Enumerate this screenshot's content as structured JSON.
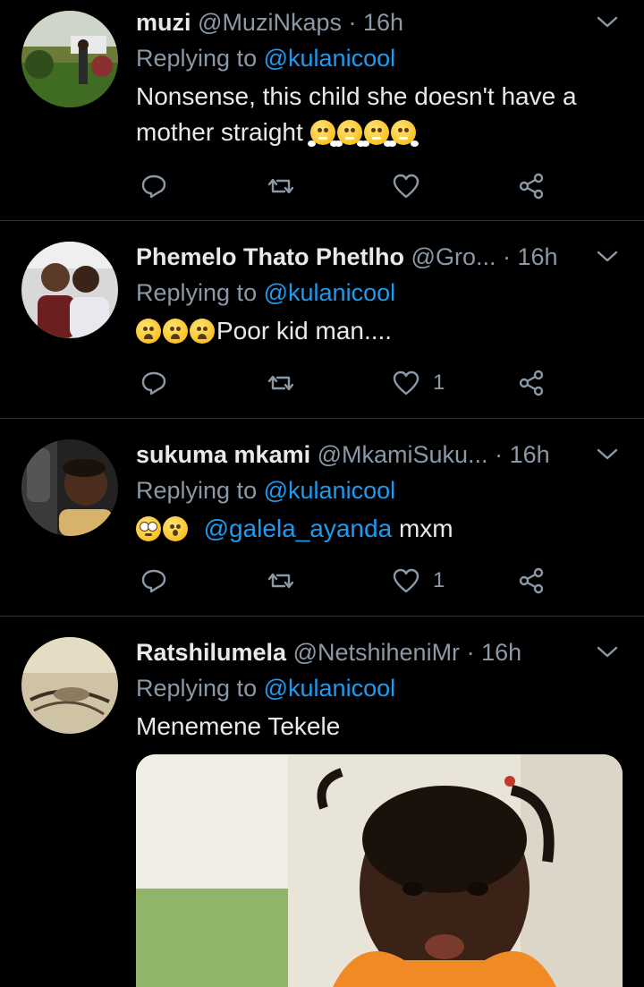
{
  "tweets": [
    {
      "name": "muzi",
      "handle": "@MuziNkaps",
      "time": "16h",
      "reply_prefix": "Replying to",
      "reply_to": "@kulanicool",
      "text": "Nonsense, this child she doesn't have a mother straight",
      "text_emojis": [
        "face-with-steam-from-nose",
        "face-with-steam-from-nose",
        "face-with-steam-from-nose",
        "face-with-steam-from-nose"
      ],
      "like_count": ""
    },
    {
      "name": "Phemelo Thato Phetlho",
      "handle": "@Gro...",
      "time": "16h",
      "reply_prefix": "Replying to",
      "reply_to": "@kulanicool",
      "text": "Poor kid man....",
      "lead_emojis": [
        "worried-face",
        "worried-face",
        "worried-face"
      ],
      "like_count": "1"
    },
    {
      "name": "sukuma mkami",
      "handle": "@MkamiSuku...",
      "time": "16h",
      "reply_prefix": "Replying to",
      "reply_to": "@kulanicool",
      "lead_emojis": [
        "face-with-rolling-eyes",
        "face-with-open-mouth"
      ],
      "mention": "@galela_ayanda",
      "text": "mxm",
      "like_count": "1"
    },
    {
      "name": "Ratshilumela",
      "handle": "@NetshiheniMr",
      "time": "16h",
      "reply_prefix": "Replying to",
      "reply_to": "@kulanicool",
      "text": "Menemene Tekele",
      "media": "child-photo"
    }
  ],
  "icons": {
    "reply": "reply-icon",
    "retweet": "retweet-icon",
    "like": "heart-icon",
    "share": "share-icon",
    "menu": "chevron-down-icon"
  },
  "colors": {
    "background": "#000000",
    "text": "#e7e9ea",
    "secondary": "#8b98a5",
    "link": "#1d9bf0",
    "divider": "#2f3336"
  },
  "separator": "·"
}
